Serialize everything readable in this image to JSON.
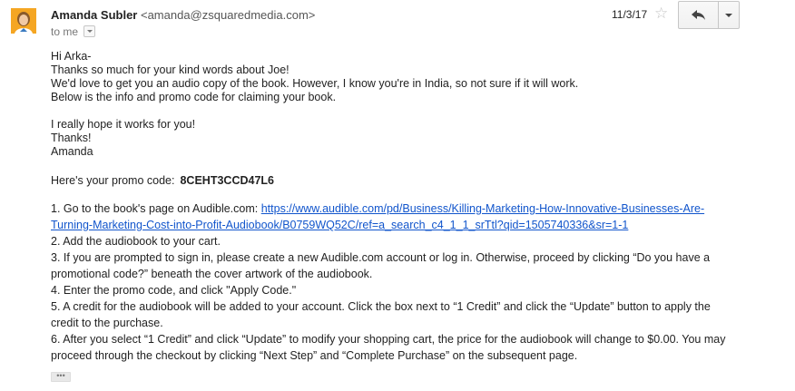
{
  "header": {
    "sender_name": "Amanda Subler",
    "sender_email": "<amanda@zsquaredmedia.com>",
    "to_label": "to me",
    "date": "11/3/17",
    "star_icon": "star-icon",
    "reply_icon": "reply-icon",
    "more_icon": "chevron-down-icon"
  },
  "message": {
    "greeting": "Hi Arka-",
    "line1": "Thanks so much for your kind words about Joe!",
    "line2": "We'd love to get you an audio copy of the book. However, I know you're in India, so not sure if it will work.",
    "line3": "Below is the info and promo code for claiming your book.",
    "hope": "I really hope it works for you!",
    "thanks": "Thanks!",
    "signature": "Amanda",
    "promo_label": "Here's your promo code:",
    "promo_code": "8CEHT3CCD47L6",
    "step1_prefix": "1. Go to the book's page on Audible.com: ",
    "step1_link": "https://www.audible.com/pd/Business/Killing-Marketing-How-Innovative-Businesses-Are-Turning-Marketing-Cost-into-Profit-Audiobook/B0759WQ52C/ref=a_search_c4_1_1_srTtl?qid=1505740336&sr=1-1",
    "step2": "2. Add the audiobook to your cart.",
    "step3": "3. If you are prompted to sign in, please create a new Audible.com account or log in. Otherwise, proceed by clicking “Do you have a promotional code?” beneath the cover artwork of the audiobook.",
    "step4": "4. Enter the promo code, and click \"Apply Code.\"",
    "step5": "5. A credit for the audiobook will be added to your account. Click the box next to “1 Credit” and click the “Update” button to apply the credit to the purchase.",
    "step6": "6. After you select “1 Credit” and click “Update” to modify your shopping cart, the price for the audiobook will change to $0.00. You may proceed through the checkout by clicking “Next Step” and “Complete Purchase” on the subsequent page."
  },
  "trimmed_content": "•••",
  "colors": {
    "link": "#1155cc",
    "avatar_bg": "#f5a623"
  }
}
